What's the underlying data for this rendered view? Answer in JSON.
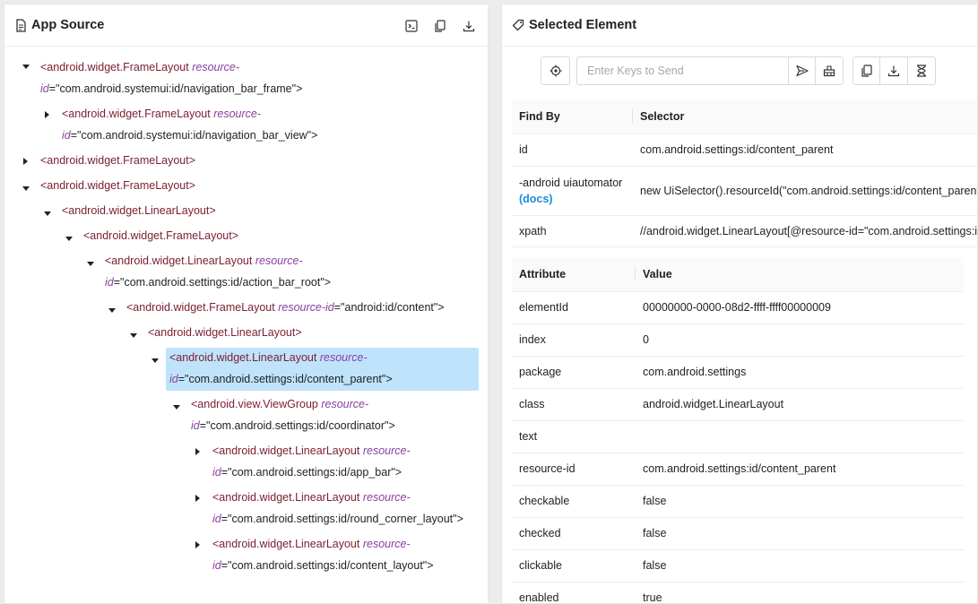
{
  "left": {
    "title": "App Source",
    "tree": [
      {
        "tag": "<android.widget.FrameLayout",
        "attr": "resource-",
        "attr2": "id",
        "val": "=\"com.android.systemui:id/navigation_bar_frame\">",
        "caret": "down"
      },
      {
        "tag": "<android.widget.FrameLayout",
        "attr": "resource-",
        "attr2": "id",
        "val": "=\"com.android.systemui:id/navigation_bar_view\">",
        "caret": "right"
      },
      {
        "tag": "<android.widget.FrameLayout>",
        "caret": "right"
      },
      {
        "tag": "<android.widget.FrameLayout>",
        "caret": "down"
      },
      {
        "tag": "<android.widget.LinearLayout>",
        "caret": "down"
      },
      {
        "tag": "<android.widget.FrameLayout>",
        "caret": "down"
      },
      {
        "tag": "<android.widget.LinearLayout",
        "attr": "resource-",
        "attr2": "id",
        "val": "=\"com.android.settings:id/action_bar_root\">",
        "caret": "down"
      },
      {
        "tag": "<android.widget.FrameLayout",
        "attr": "resource-id",
        "val": "=\"android:id/content\">",
        "caret": "down"
      },
      {
        "tag": "<android.widget.LinearLayout>",
        "caret": "down"
      },
      {
        "tag": "<android.widget.LinearLayout",
        "attr": "resource-",
        "attr2": "id",
        "val": "=\"com.android.settings:id/content_parent\">",
        "caret": "down",
        "selected": true
      },
      {
        "tag": "<android.view.ViewGroup",
        "attr": "resource-",
        "attr2": "id",
        "val": "=\"com.android.settings:id/coordinator\">",
        "caret": "down"
      },
      {
        "tag": "<android.widget.LinearLayout",
        "attr": "resource-",
        "attr2": "id",
        "val": "=\"com.android.settings:id/app_bar\">",
        "caret": "right"
      },
      {
        "tag": "<android.widget.LinearLayout",
        "attr": "resource-",
        "attr2": "id",
        "val": "=\"com.android.settings:id/round_corner_layout\">",
        "caret": "right"
      },
      {
        "tag": "<android.widget.LinearLayout",
        "attr": "resource-",
        "attr2": "id",
        "val": "=\"com.android.settings:id/content_layout\">",
        "caret": "right"
      }
    ]
  },
  "right": {
    "title": "Selected Element",
    "keys_placeholder": "Enter Keys to Send",
    "find_headers": {
      "find_by": "Find By",
      "selector": "Selector"
    },
    "find_rows": [
      {
        "by": "id",
        "selector": "com.android.settings:id/content_parent"
      },
      {
        "by": "-android uiautomator",
        "docs": "(docs)",
        "selector": "new UiSelector().resourceId(\"com.android.settings:id/content_parent\")"
      },
      {
        "by": "xpath",
        "selector": "//android.widget.LinearLayout[@resource-id=\"com.android.settings:id/content_parent\"]"
      }
    ],
    "attr_headers": {
      "attribute": "Attribute",
      "value": "Value"
    },
    "attr_rows": [
      {
        "name": "elementId",
        "value": "00000000-0000-08d2-ffff-ffff00000009"
      },
      {
        "name": "index",
        "value": "0"
      },
      {
        "name": "package",
        "value": "com.android.settings"
      },
      {
        "name": "class",
        "value": "android.widget.LinearLayout"
      },
      {
        "name": "text",
        "value": ""
      },
      {
        "name": "resource-id",
        "value": "com.android.settings:id/content_parent"
      },
      {
        "name": "checkable",
        "value": "false"
      },
      {
        "name": "checked",
        "value": "false"
      },
      {
        "name": "clickable",
        "value": "false"
      },
      {
        "name": "enabled",
        "value": "true"
      }
    ]
  },
  "icons": {
    "left_header": [
      "terminal-icon",
      "copy-icon",
      "download-icon"
    ],
    "toolbar": [
      "tap-target-icon",
      "send-keys-icon",
      "clear-icon",
      "copy-attributes-icon",
      "download-icon",
      "timing-icon"
    ]
  },
  "colors": {
    "selection": "#bfe3fb",
    "tag": "#7a1d2f",
    "attr": "#8a3fa0",
    "link": "#1a8ce0"
  }
}
